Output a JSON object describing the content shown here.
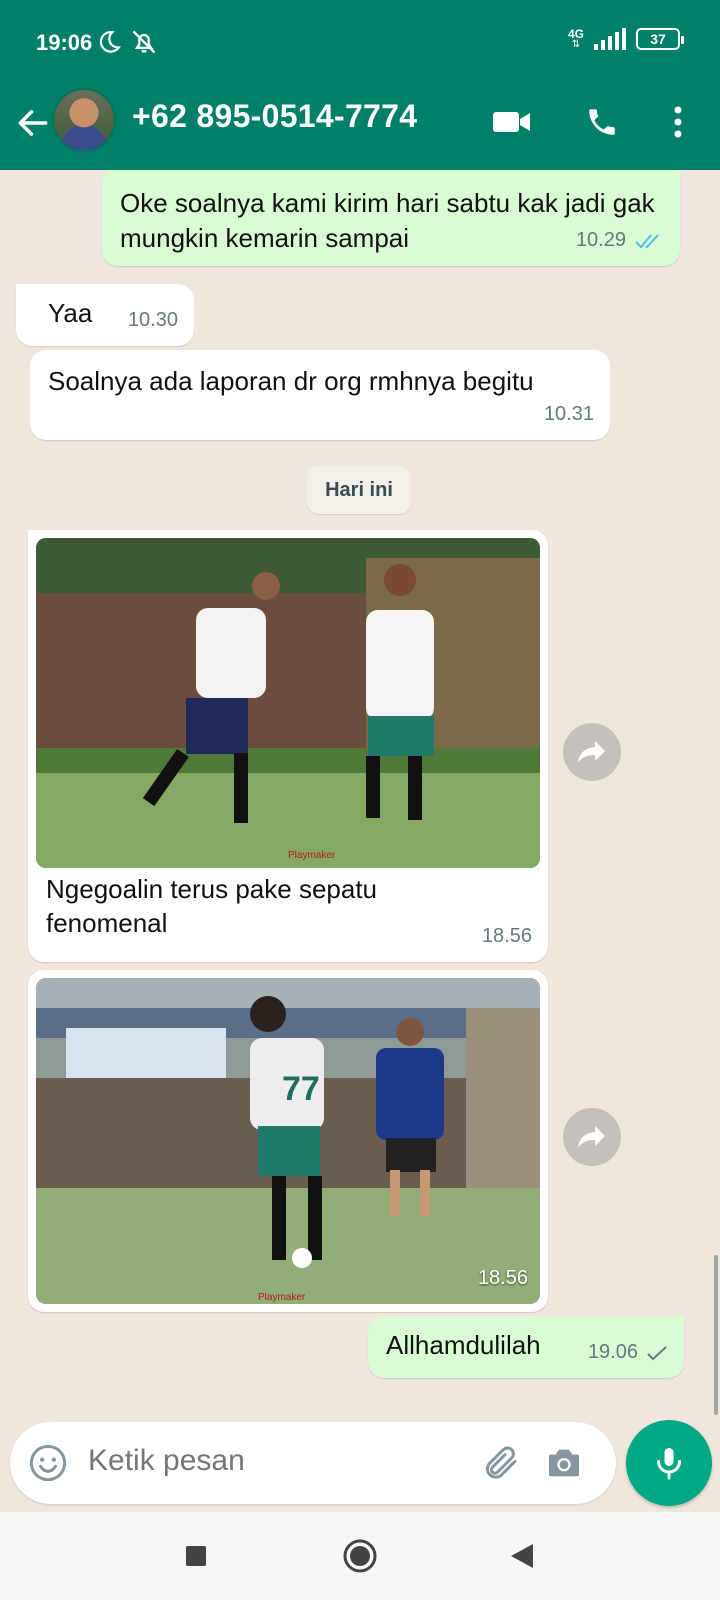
{
  "status_bar": {
    "time": "19:06",
    "network": "4G",
    "battery": "37"
  },
  "contact": {
    "name": "+62 895-0514-7774"
  },
  "messages": [
    {
      "direction": "out",
      "text": "Oke soalnya kami kirim hari sabtu kak jadi gak mungkin kemarin sampai",
      "time": "10.29",
      "status": "read"
    },
    {
      "direction": "in",
      "text": "Yaa",
      "time": "10.30"
    },
    {
      "direction": "in",
      "text": "Soalnya ada laporan dr org rmhnya begitu",
      "time": "10.31"
    },
    {
      "direction": "in",
      "type": "image",
      "caption": "Ngegoalin terus pake sepatu fenomenal",
      "time": "18.56",
      "watermark": "Playmaker"
    },
    {
      "direction": "in",
      "type": "image",
      "time": "18.56",
      "watermark": "Playmaker",
      "jersey_number": "77"
    },
    {
      "direction": "out",
      "text": "Allhamdulilah",
      "time": "19.06",
      "status": "sent"
    }
  ],
  "date_separator": "Hari ini",
  "composer": {
    "placeholder": "Ketik pesan"
  },
  "colors": {
    "header": "#008069",
    "outgoing_bubble": "#d9fdd3",
    "accent": "#00a884",
    "read_ticks": "#53bdeb"
  }
}
